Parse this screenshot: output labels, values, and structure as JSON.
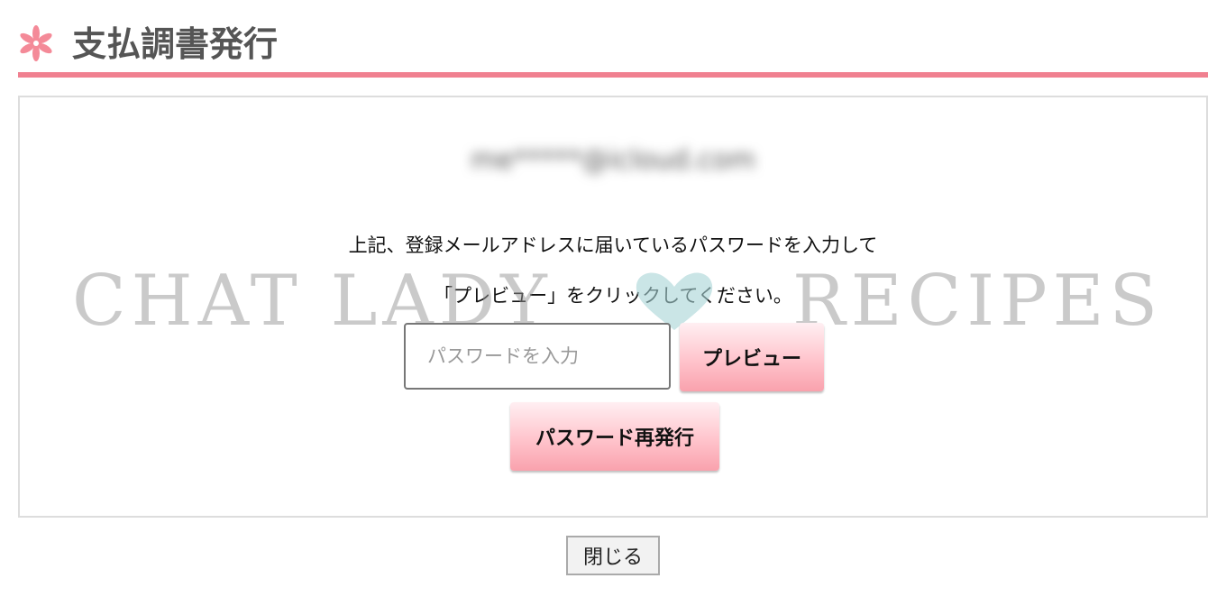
{
  "header": {
    "title": "支払調書発行",
    "icon": "asterisk-flower-icon",
    "accent_color": "#f08090"
  },
  "panel": {
    "email": "me*****@icloud.com",
    "instruction_line1": "上記、登録メールアドレスに届いているパスワードを入力して",
    "instruction_line2": "「プレビュー」をクリックしてください。",
    "password_input": {
      "value": "",
      "placeholder": "パスワードを入力"
    },
    "preview_button": "プレビュー",
    "reissue_button": "パスワード再発行"
  },
  "watermark": {
    "left_text": "CHAT LADY",
    "right_text": "RECIPES",
    "icon": "heart-icon",
    "heart_color": "#a6d4d6"
  },
  "footer": {
    "close_button": "閉じる"
  },
  "colors": {
    "button_pink_top": "#ffeff2",
    "button_pink_bottom": "#f9a2ad",
    "panel_border": "#dddddd"
  }
}
